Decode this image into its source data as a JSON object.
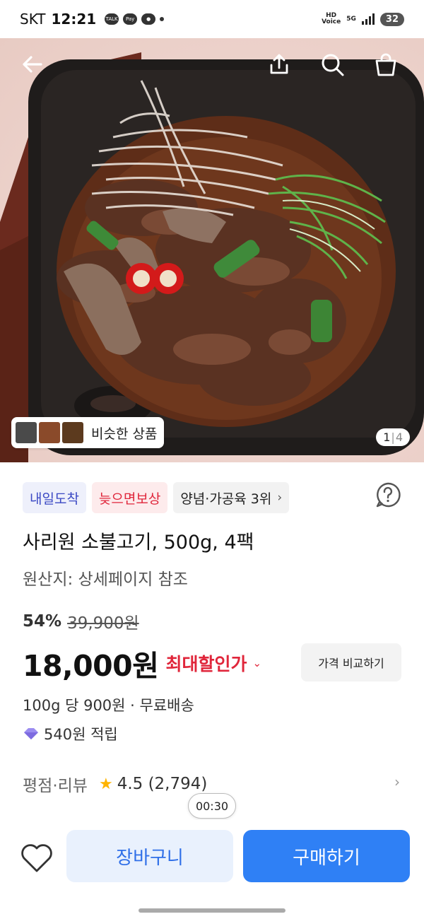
{
  "status_bar": {
    "carrier": "SKT",
    "time": "12:21",
    "battery": "32",
    "network": "5G"
  },
  "hero": {
    "similar_label": "비슷한 상품",
    "page_current": "1",
    "page_total": "4"
  },
  "badges": [
    "내일도착",
    "늦으면보상",
    "양념·가공육 3위"
  ],
  "product": {
    "title": "사리원 소불고기, 500g, 4팩",
    "origin": "원산지: 상세페이지 참조",
    "discount": "54%",
    "original_price": "39,900원",
    "price": "18,000원",
    "max_discount_label": "최대할인가",
    "compare_label": "가격 비교하기",
    "unit_price": "100g 당 900원 · 무료배송",
    "points": "540원 적립"
  },
  "rating": {
    "label": "평점·리뷰",
    "value": "4.5 (2,794)"
  },
  "timer": "00:30",
  "bottom_bar": {
    "cart_label": "장바구니",
    "buy_label": "구매하기"
  },
  "colors": {
    "accent_blue": "#2f80f5",
    "discount_red": "#e0263b",
    "star": "#ffb400"
  }
}
